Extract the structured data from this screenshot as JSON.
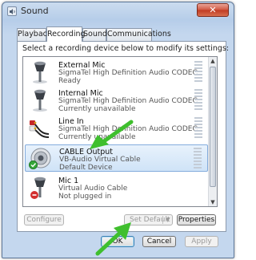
{
  "window": {
    "title": "Sound",
    "close_label": "✕"
  },
  "tabs": [
    {
      "label": "Playback"
    },
    {
      "label": "Recording"
    },
    {
      "label": "Sounds"
    },
    {
      "label": "Communications"
    }
  ],
  "active_tab": "Recording",
  "instruction": "Select a recording device below to modify its settings:",
  "devices": [
    {
      "name": "External Mic",
      "description": "SigmaTel High Definition Audio CODEC",
      "status": "Ready",
      "icon": "microphone-icon",
      "selected": false
    },
    {
      "name": "Internal Mic",
      "description": "SigmaTel High Definition Audio CODEC",
      "status": "Currently unavailable",
      "icon": "microphone-icon",
      "selected": false
    },
    {
      "name": "Line In",
      "description": "SigmaTel High Definition Audio CODEC",
      "status": "Currently unavailable",
      "icon": "line-in-cable-icon",
      "selected": false
    },
    {
      "name": "CABLE Output",
      "description": "VB-Audio Virtual Cable",
      "status": "Default Device",
      "icon": "virtual-cable-icon",
      "selected": true,
      "default_check": true
    },
    {
      "name": "Mic 1",
      "description": "Virtual Audio Cable",
      "status": "Not plugged in",
      "icon": "microphone-icon",
      "selected": false
    }
  ],
  "buttons": {
    "configure": "Configure",
    "set_default": "Set Default",
    "properties": "Properties",
    "ok": "OK",
    "cancel": "Cancel",
    "apply": "Apply"
  },
  "colors": {
    "selection_border": "#84acdd",
    "annotation_arrow": "#3fbf2e",
    "default_check": "#35a83a"
  }
}
